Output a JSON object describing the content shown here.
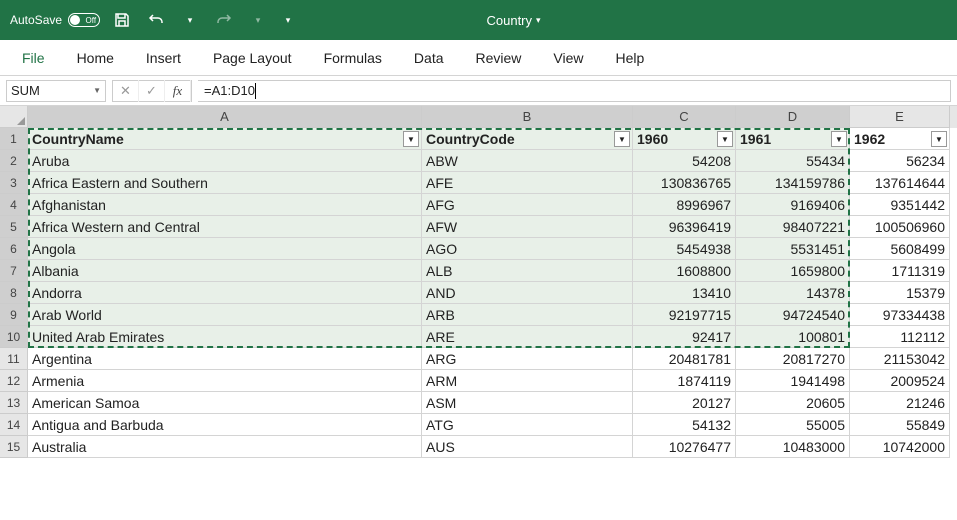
{
  "titlebar": {
    "autosave_label": "AutoSave",
    "autosave_state": "Off",
    "doc_title": "Country"
  },
  "ribbon": {
    "tabs": [
      "File",
      "Home",
      "Insert",
      "Page Layout",
      "Formulas",
      "Data",
      "Review",
      "View",
      "Help"
    ]
  },
  "formula_bar": {
    "name_box": "SUM",
    "formula": "=A1:D10"
  },
  "columns": [
    "A",
    "B",
    "C",
    "D",
    "E"
  ],
  "headers": {
    "A": "CountryName",
    "B": "CountryCode",
    "C": "1960",
    "D": "1961",
    "E": "1962"
  },
  "rows": [
    {
      "n": 2,
      "A": "Aruba",
      "B": "ABW",
      "C": "54208",
      "D": "55434",
      "E": "56234"
    },
    {
      "n": 3,
      "A": "Africa Eastern and Southern",
      "B": "AFE",
      "C": "130836765",
      "D": "134159786",
      "E": "137614644"
    },
    {
      "n": 4,
      "A": "Afghanistan",
      "B": "AFG",
      "C": "8996967",
      "D": "9169406",
      "E": "9351442"
    },
    {
      "n": 5,
      "A": "Africa Western and Central",
      "B": "AFW",
      "C": "96396419",
      "D": "98407221",
      "E": "100506960"
    },
    {
      "n": 6,
      "A": "Angola",
      "B": "AGO",
      "C": "5454938",
      "D": "5531451",
      "E": "5608499"
    },
    {
      "n": 7,
      "A": "Albania",
      "B": "ALB",
      "C": "1608800",
      "D": "1659800",
      "E": "1711319"
    },
    {
      "n": 8,
      "A": "Andorra",
      "B": "AND",
      "C": "13410",
      "D": "14378",
      "E": "15379"
    },
    {
      "n": 9,
      "A": "Arab World",
      "B": "ARB",
      "C": "92197715",
      "D": "94724540",
      "E": "97334438"
    },
    {
      "n": 10,
      "A": "United Arab Emirates",
      "B": "ARE",
      "C": "92417",
      "D": "100801",
      "E": "112112"
    },
    {
      "n": 11,
      "A": "Argentina",
      "B": "ARG",
      "C": "20481781",
      "D": "20817270",
      "E": "21153042"
    },
    {
      "n": 12,
      "A": "Armenia",
      "B": "ARM",
      "C": "1874119",
      "D": "1941498",
      "E": "2009524"
    },
    {
      "n": 13,
      "A": "American Samoa",
      "B": "ASM",
      "C": "20127",
      "D": "20605",
      "E": "21246"
    },
    {
      "n": 14,
      "A": "Antigua and Barbuda",
      "B": "ATG",
      "C": "54132",
      "D": "55005",
      "E": "55849"
    },
    {
      "n": 15,
      "A": "Australia",
      "B": "AUS",
      "C": "10276477",
      "D": "10483000",
      "E": "10742000"
    }
  ],
  "selection": {
    "first_row": 1,
    "last_row": 10,
    "cols": [
      "A",
      "B",
      "C",
      "D"
    ]
  }
}
